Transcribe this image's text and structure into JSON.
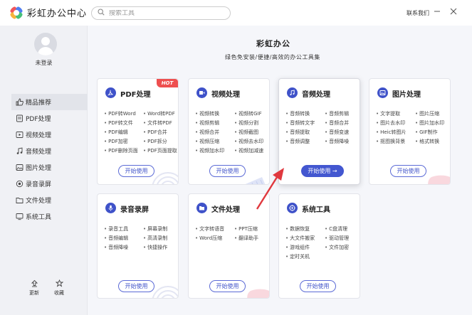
{
  "app": {
    "title": "彩虹办公中心"
  },
  "search": {
    "placeholder": "搜索工具"
  },
  "header": {
    "contact": "联系我们"
  },
  "user": {
    "status": "未登录"
  },
  "sidebar": {
    "items": [
      {
        "label": "精品推荐",
        "icon": "thumbs-up-icon",
        "active": true
      },
      {
        "label": "PDF处理",
        "icon": "pdf-icon"
      },
      {
        "label": "视频处理",
        "icon": "video-icon"
      },
      {
        "label": "音频处理",
        "icon": "music-icon"
      },
      {
        "label": "图片处理",
        "icon": "image-icon"
      },
      {
        "label": "录音录屏",
        "icon": "record-icon"
      },
      {
        "label": "文件处理",
        "icon": "folder-icon"
      },
      {
        "label": "系统工具",
        "icon": "system-icon"
      }
    ],
    "bottom": {
      "update": "更新",
      "favorite": "收藏"
    }
  },
  "main": {
    "title": "彩虹办公",
    "subtitle": "绿色免安装/便捷/高效的办公工具集"
  },
  "cards": [
    {
      "title": "PDF处理",
      "badge": "HOT",
      "button": "开始使用",
      "features": [
        "PDF转Word",
        "Word转PDF",
        "PDF转文件",
        "文件转PDF",
        "PDF编辑",
        "PDF合并",
        "PDF加密",
        "PDF拆分",
        "PDF删除页面",
        "PDF页面提取"
      ]
    },
    {
      "title": "视频处理",
      "button": "开始使用",
      "features": [
        "视频转换",
        "视频转GIF",
        "视频剪辑",
        "视频分割",
        "视频合并",
        "视频截图",
        "视频压缩",
        "视频去水印",
        "视频加水印",
        "视频加减速"
      ]
    },
    {
      "title": "音频处理",
      "button": "开始使用 →",
      "features": [
        "音频转换",
        "音频剪辑",
        "音频转文字",
        "音频合并",
        "音频提取",
        "音频变速",
        "音频调整",
        "音频降噪"
      ]
    },
    {
      "title": "图片处理",
      "button": "开始使用",
      "features": [
        "文字提取",
        "图片压缩",
        "图片去水印",
        "图片加水印",
        "Heic转图片",
        "GIF制作",
        "抠图换背景",
        "格式转换"
      ]
    },
    {
      "title": "录音录屏",
      "button": "开始使用",
      "features": [
        "录音工具",
        "屏幕录制",
        "音频编辑",
        "高清录制",
        "音频降噪",
        "快捷操作"
      ]
    },
    {
      "title": "文件处理",
      "button": "开始使用",
      "features": [
        "文字转语音",
        "PPT压缩",
        "Word压缩",
        "翻译助手"
      ]
    },
    {
      "title": "系统工具",
      "button": "开始使用",
      "features": [
        "数据恢复",
        "C盘清理",
        "大文件搬家",
        "驱动管理",
        "游戏组件",
        "文件加密",
        "定时关机"
      ]
    }
  ],
  "colors": {
    "accent": "#4357d0",
    "hot": "#ee4f4f",
    "arrow": "#e0383e"
  }
}
